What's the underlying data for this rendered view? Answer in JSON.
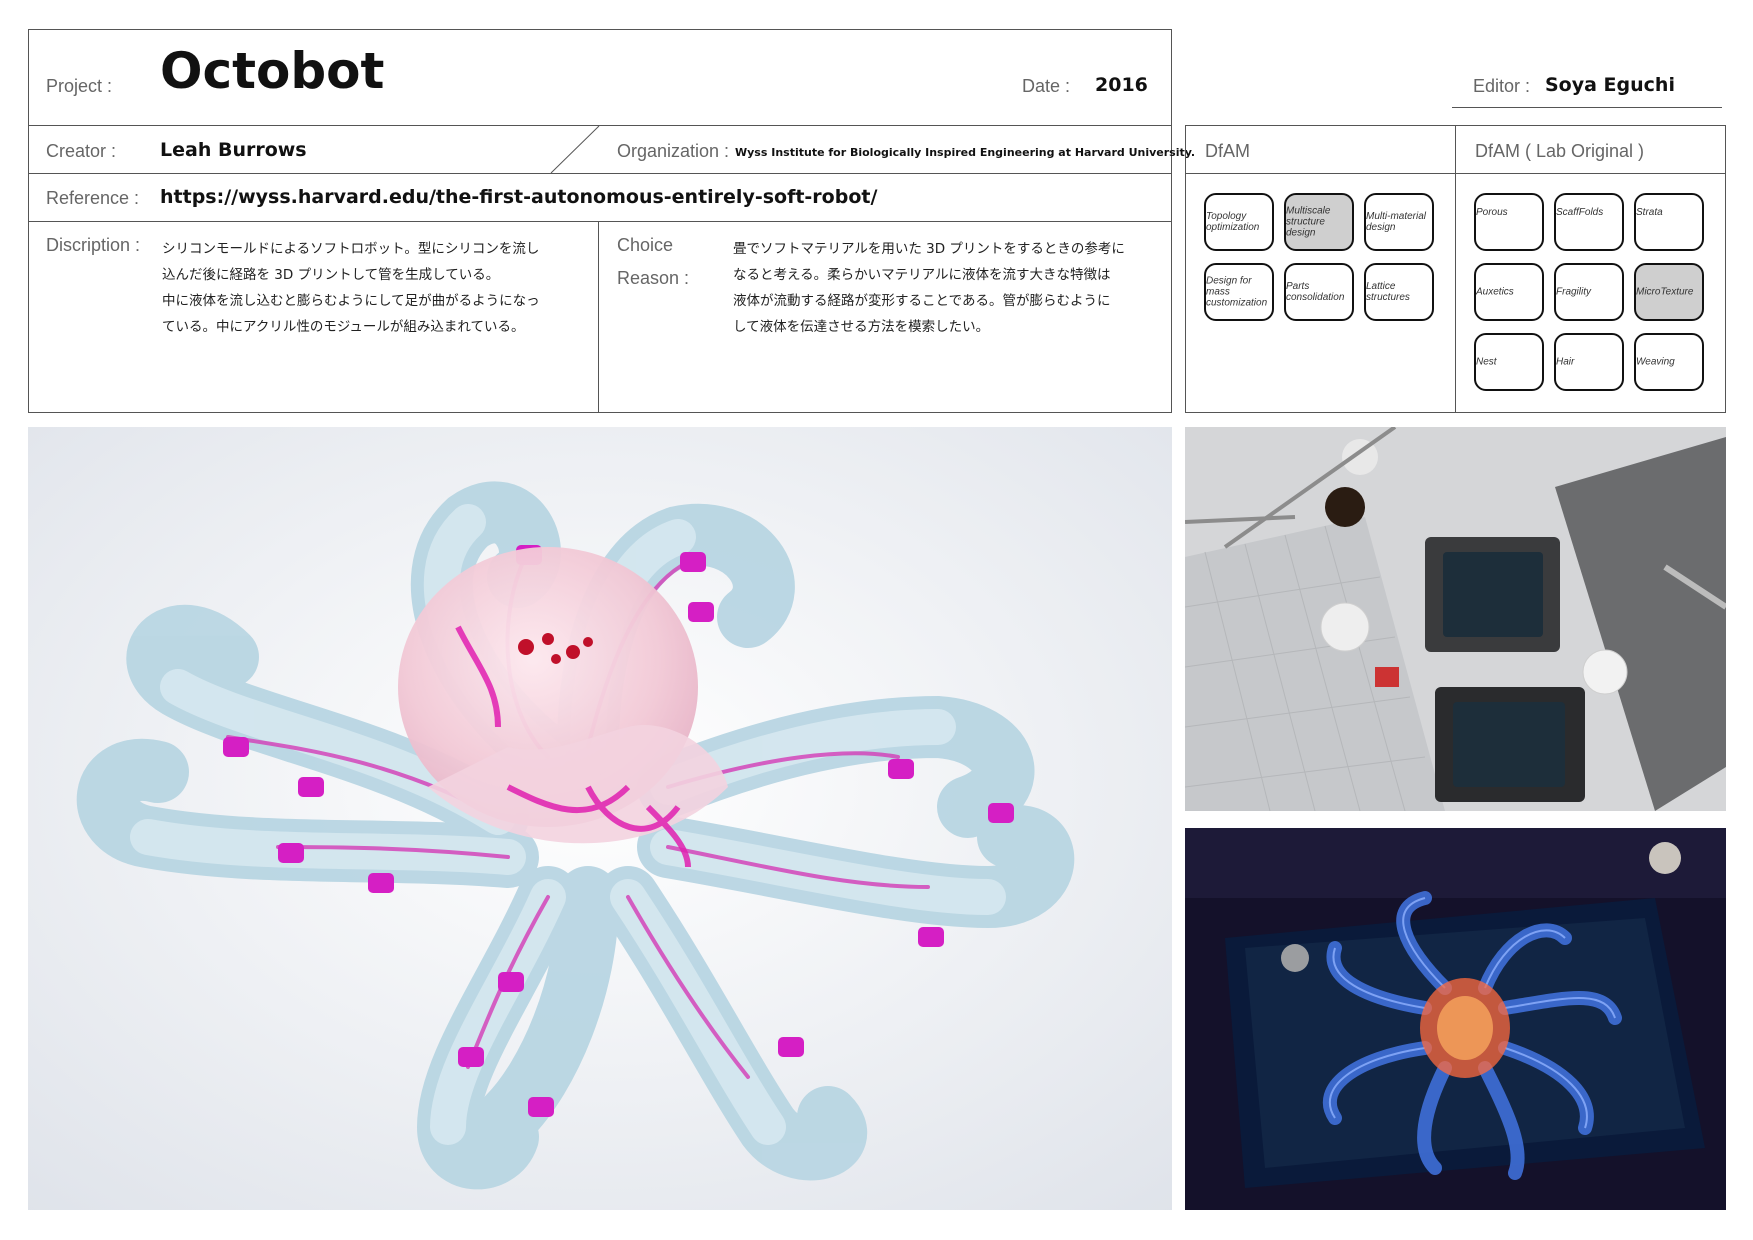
{
  "header": {
    "project_label": "Project :",
    "project_title": "Octobot",
    "date_label": "Date :",
    "date_value": "2016",
    "editor_label": "Editor :",
    "editor_value": "Soya Eguchi"
  },
  "info": {
    "creator_label": "Creator :",
    "creator_value": "Leah Burrows",
    "organization_label": "Organization :",
    "organization_value": "Wyss Institute for Biologically Inspired Engineering at Harvard University.",
    "reference_label": "Reference :",
    "reference_value": "https://wyss.harvard.edu/the-first-autonomous-entirely-soft-robot/",
    "description_label": "Discription :",
    "description_lines": [
      "シリコンモールドによるソフトロボット。型にシリコンを流し",
      "込んだ後に経路を 3D プリントして管を生成している。",
      "中に液体を流し込むと膨らむようにして足が曲がるようになっ",
      "ている。中にアクリル性のモジュールが組み込まれている。"
    ],
    "choice_label_1": "Choice",
    "choice_label_2": "Reason :",
    "choice_lines": [
      "畳でソフトマテリアルを用いた 3D プリントをするときの参考に",
      "なると考える。柔らかいマテリアルに液体を流す大きな特徴は",
      "液体が流動する経路が変形することである。管が膨らむように",
      "して液体を伝達させる方法を模索したい。"
    ]
  },
  "dfam": {
    "title": "DfAM",
    "items": [
      {
        "label_lines": [
          "Topology",
          "optimization"
        ],
        "selected": false
      },
      {
        "label_lines": [
          "Multiscale",
          "structure",
          "design"
        ],
        "selected": true
      },
      {
        "label_lines": [
          "Multi-material",
          "design"
        ],
        "selected": false
      },
      {
        "label_lines": [
          "Design for",
          "mass",
          "customization"
        ],
        "selected": false
      },
      {
        "label_lines": [
          "Parts",
          "consolidation"
        ],
        "selected": false
      },
      {
        "label_lines": [
          "Lattice",
          "structures"
        ],
        "selected": false
      }
    ]
  },
  "lab": {
    "title": "DfAM ( Lab Original )",
    "items": [
      {
        "label": "Porous",
        "selected": false
      },
      {
        "label": "ScaffFolds",
        "selected": false
      },
      {
        "label": "Strata",
        "selected": false
      },
      {
        "label": "Auxetics",
        "selected": false
      },
      {
        "label": "Fragility",
        "selected": false
      },
      {
        "label": "MicroTexture",
        "selected": true
      },
      {
        "label": "Nest",
        "selected": false
      },
      {
        "label": "Hair",
        "selected": false
      },
      {
        "label": "Weaving",
        "selected": false
      }
    ]
  },
  "colors": {
    "border": "#555555",
    "selected_chip": "#cfcfcf",
    "tentacle": "#bcd9e6",
    "magenta": "#e020b0"
  },
  "images": {
    "main": "octobot-photo",
    "tools": "fabrication-tools-photo",
    "glow": "uv-glow-photo"
  }
}
